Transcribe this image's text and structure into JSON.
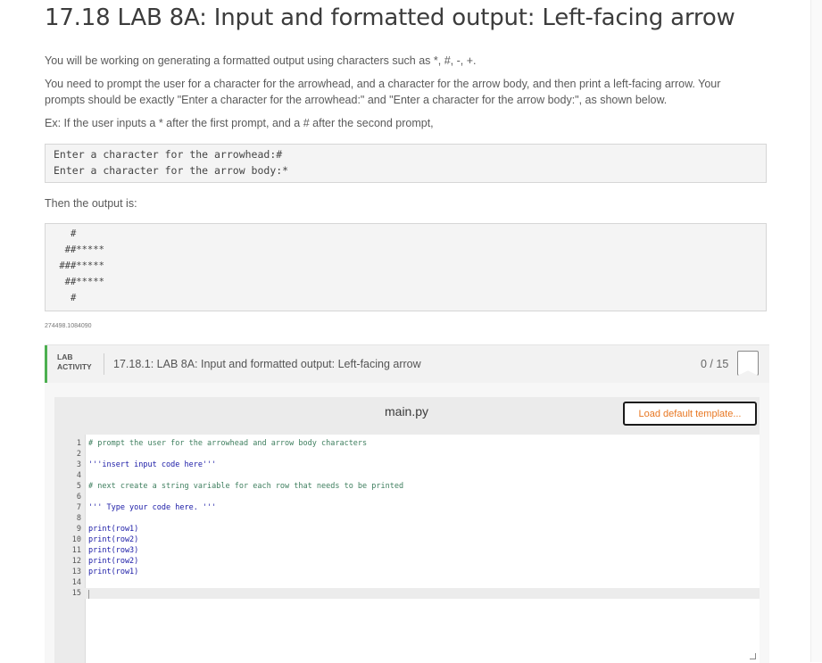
{
  "page": {
    "title": "17.18 LAB 8A: Input and formatted output: Left-facing arrow",
    "para1": "You will be working on generating a formatted output using characters such as *, #, -, +.",
    "para2a": "You need to prompt the user for a character for the arrowhead, and a character for the arrow body, and then print a left-facing arrow. Your",
    "para2b": "prompts should be exactly \"Enter a character for the arrowhead:\" and \"Enter a character for the arrow body:\", as shown below.",
    "para3": "Ex: If the user inputs a * after the first prompt, and a # after the second prompt,",
    "example_input": [
      "Enter a character for the arrowhead:#",
      "Enter a character for the arrow body:*"
    ],
    "then_text": "Then the output is:",
    "example_output": [
      "   #",
      "  ##*****",
      " ###*****",
      "  ##*****",
      "   #"
    ],
    "content_id": "274498.1084090"
  },
  "lab": {
    "tag_line1": "LAB",
    "tag_line2": "ACTIVITY",
    "title": "17.18.1: LAB 8A: Input and formatted output: Left-facing arrow",
    "score": "0 / 15",
    "file_name": "main.py",
    "load_button": "Load default template...",
    "code_lines": [
      {
        "n": "1",
        "text": "# prompt the user for the arrowhead and arrow body characters",
        "kind": "com"
      },
      {
        "n": "2",
        "text": "",
        "kind": "code"
      },
      {
        "n": "3",
        "text": "'''insert input code here'''",
        "kind": "str"
      },
      {
        "n": "4",
        "text": "",
        "kind": "code"
      },
      {
        "n": "5",
        "text": "# next create a string variable for each row that needs to be printed",
        "kind": "com"
      },
      {
        "n": "6",
        "text": "",
        "kind": "code"
      },
      {
        "n": "7",
        "text": "''' Type your code here. '''",
        "kind": "str"
      },
      {
        "n": "8",
        "text": "",
        "kind": "code"
      },
      {
        "n": "9",
        "text": "print(row1)",
        "kind": "code"
      },
      {
        "n": "10",
        "text": "print(row2)",
        "kind": "code"
      },
      {
        "n": "11",
        "text": "print(row3)",
        "kind": "code"
      },
      {
        "n": "12",
        "text": "print(row2)",
        "kind": "code"
      },
      {
        "n": "13",
        "text": "print(row1)",
        "kind": "code"
      },
      {
        "n": "14",
        "text": "",
        "kind": "code"
      },
      {
        "n": "15",
        "text": "",
        "kind": "code"
      }
    ]
  },
  "colors": {
    "accent_green": "#4caf50",
    "button_text": "#e87722"
  }
}
